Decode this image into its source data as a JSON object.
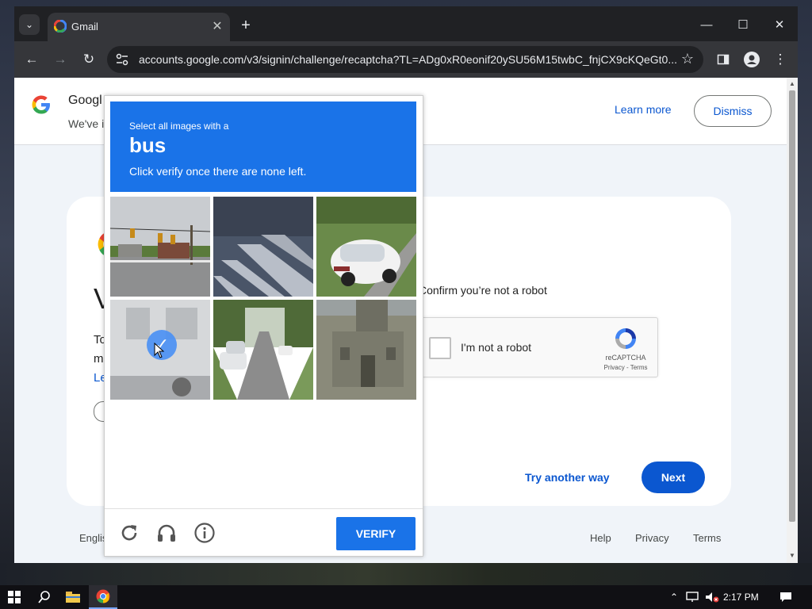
{
  "browser": {
    "tab_title": "Gmail",
    "url": "accounts.google.com/v3/signin/challenge/recaptcha?TL=ADg0xR0eonif20ySU56M15twbC_fnjCX9cKQeGt0..."
  },
  "banner": {
    "title": "Googl",
    "subtitle": "We've i",
    "learn_more": "Learn more",
    "dismiss": "Dismiss"
  },
  "card": {
    "heading": "V",
    "body_line1": "To",
    "body_line2": "m",
    "link_fragment": "Le",
    "confirm_text": "Confirm you’re not a robot",
    "recaptcha_label": "I'm not a robot",
    "recaptcha_brand": "reCAPTCHA",
    "recaptcha_terms": "Privacy - Terms",
    "try_another": "Try another way",
    "next": "Next"
  },
  "footer": {
    "language": "Englis",
    "help": "Help",
    "privacy": "Privacy",
    "terms": "Terms"
  },
  "captcha": {
    "instruction_line1": "Select all images with a",
    "target": "bus",
    "instruction_line2": "Click verify once there are none left.",
    "verify": "VERIFY",
    "tiles": [
      {
        "content": "intersection-traffic-lights",
        "selected": false
      },
      {
        "content": "crosswalk-stripes",
        "selected": false
      },
      {
        "content": "white-car",
        "selected": false
      },
      {
        "content": "bus-side",
        "selected": true
      },
      {
        "content": "street-parked-cars",
        "selected": false
      },
      {
        "content": "stone-building",
        "selected": false
      }
    ],
    "icons": [
      "reload-icon",
      "audio-icon",
      "info-icon"
    ]
  },
  "taskbar": {
    "time": "2:17 PM"
  },
  "colors": {
    "captcha_blue": "#1a73e8",
    "google_blue": "#0b57d0",
    "page_bg": "#f0f4f9"
  }
}
